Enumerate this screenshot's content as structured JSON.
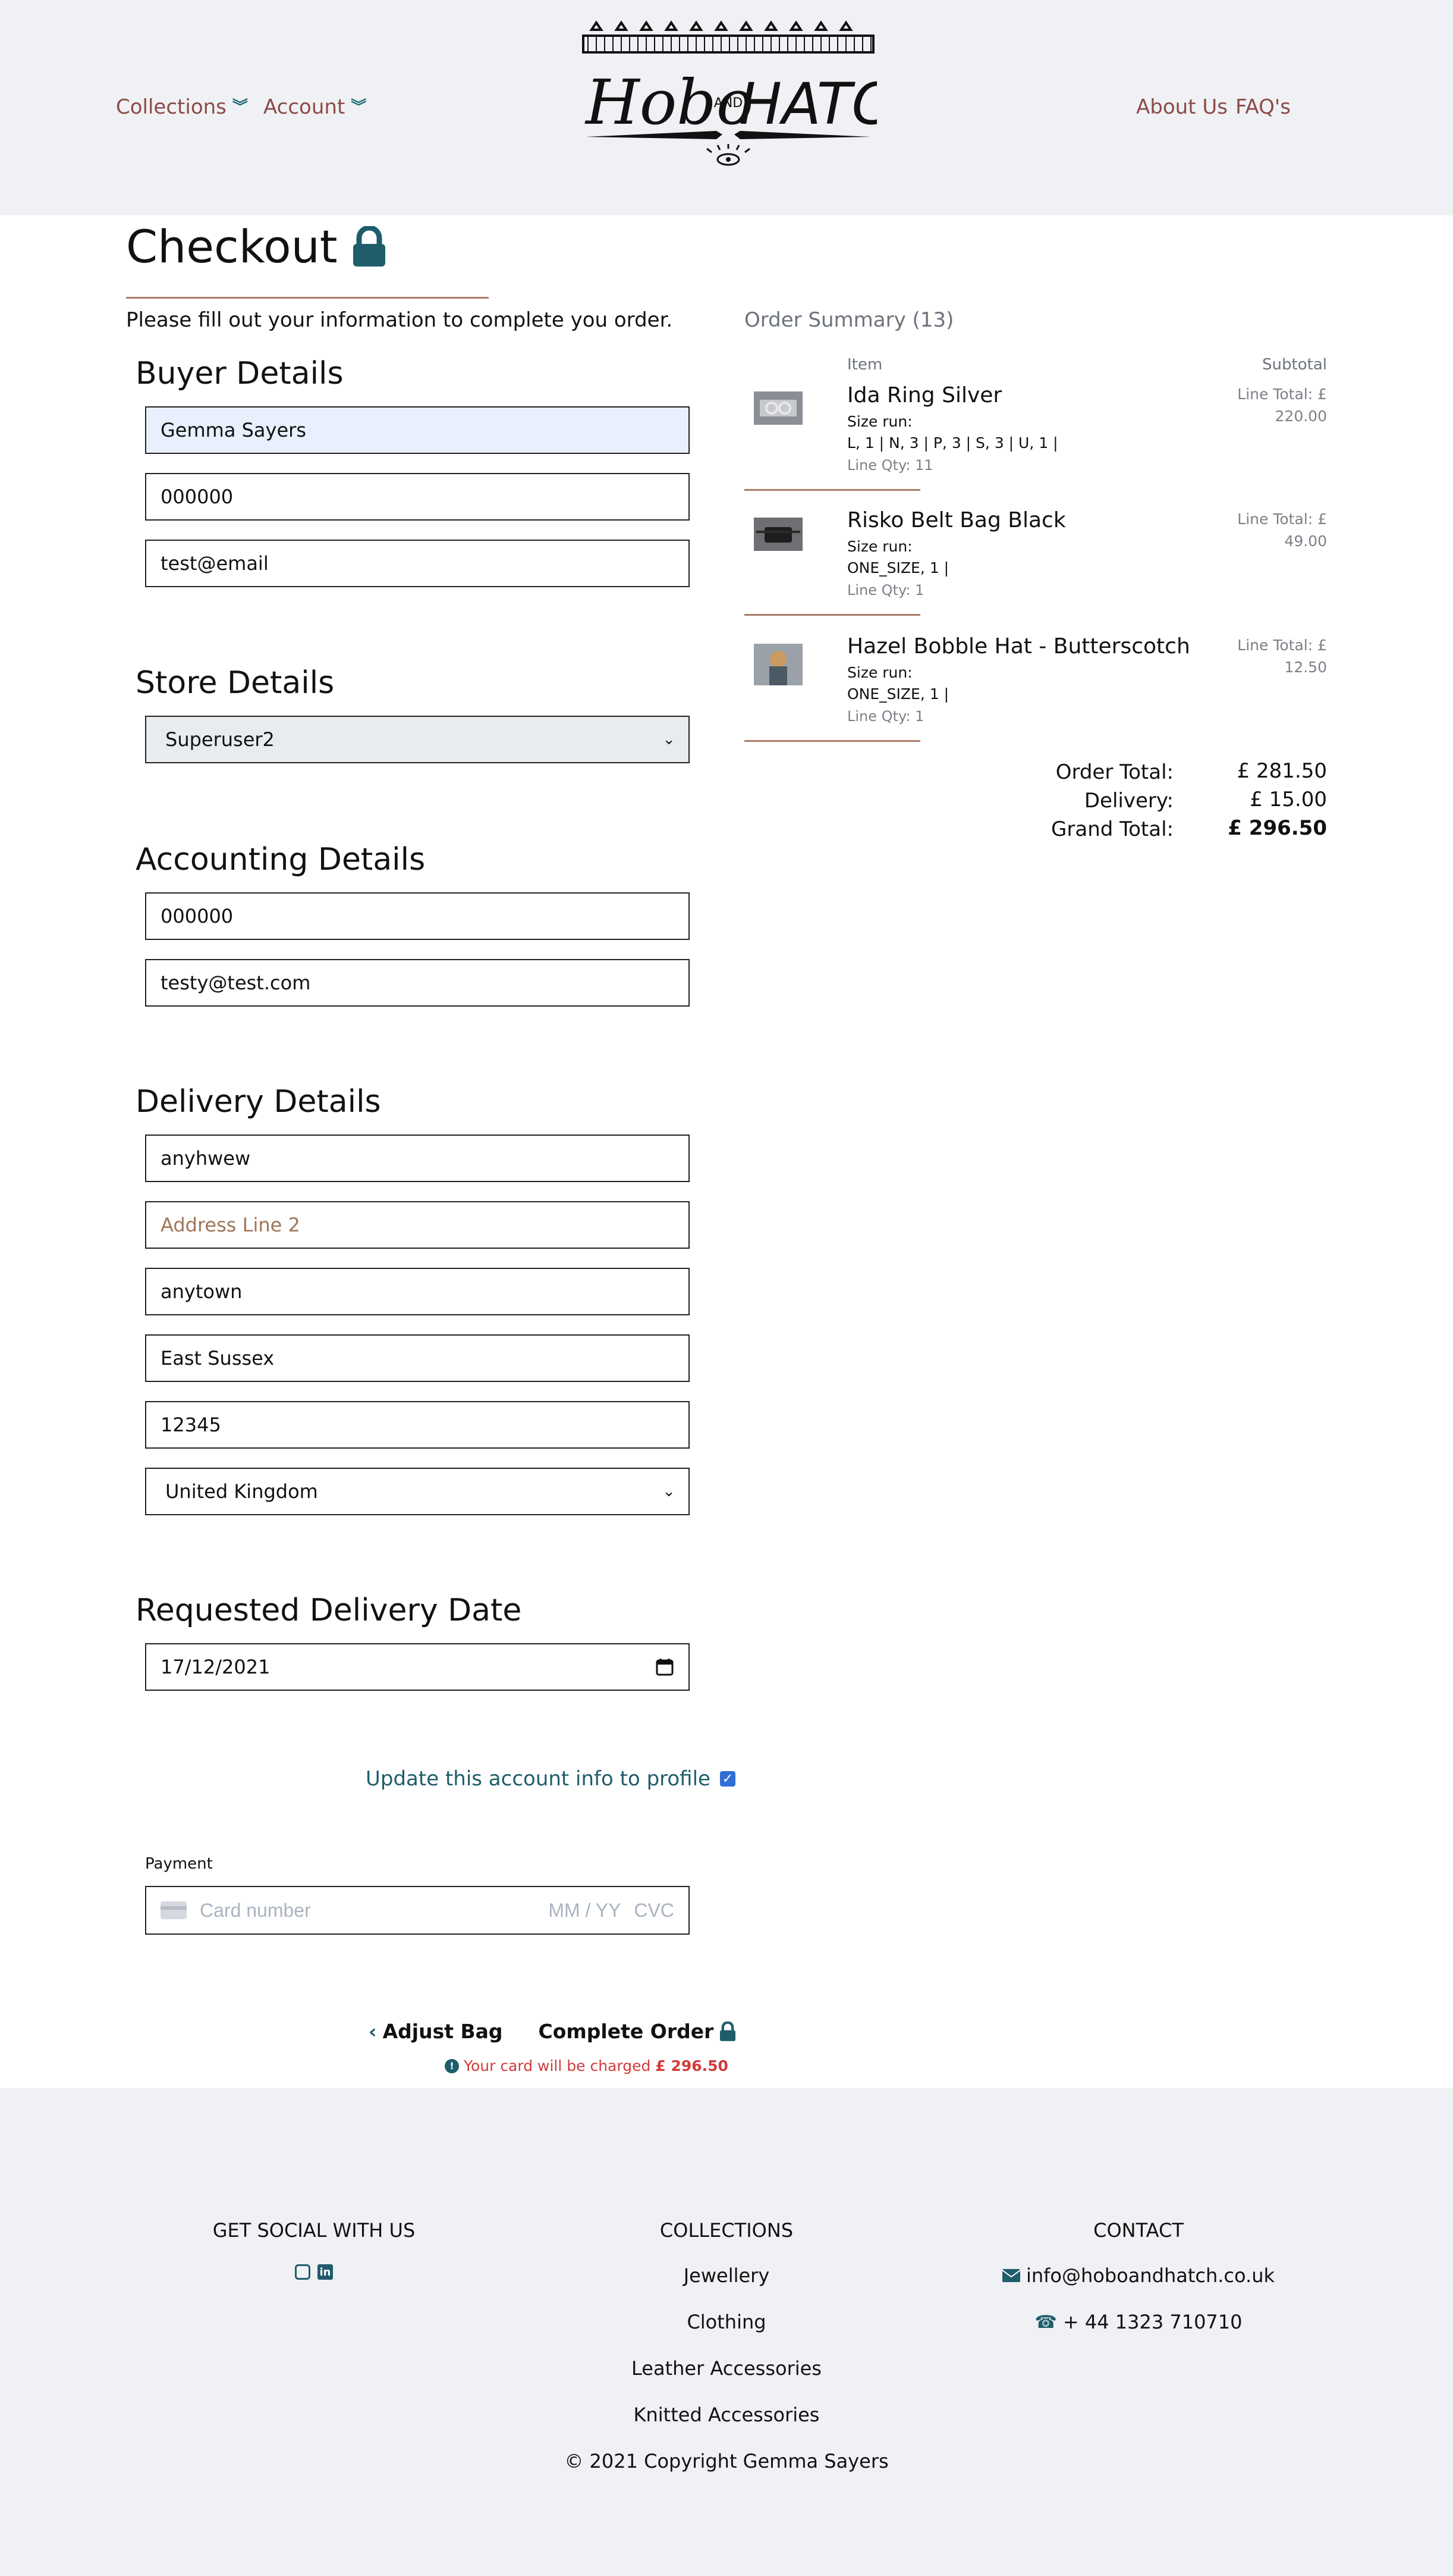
{
  "nav": {
    "collections": "Collections",
    "account": "Account",
    "about": "About Us",
    "faqs": "FAQ's",
    "logo_text_left": "Hobo",
    "logo_text_mid": "AND",
    "logo_text_right": "HATCH"
  },
  "checkout": {
    "title": "Checkout",
    "intro": "Please fill out your information to complete you order."
  },
  "buyer": {
    "heading": "Buyer Details",
    "name": "Gemma Sayers",
    "phone": "000000",
    "email": "test@email"
  },
  "store": {
    "heading": "Store Details",
    "selected": "Superuser2"
  },
  "accounting": {
    "heading": "Accounting Details",
    "phone": "000000",
    "email": "testy@test.com"
  },
  "delivery": {
    "heading": "Delivery Details",
    "line1": "anyhwew",
    "line2_placeholder": "Address Line 2",
    "town": "anytown",
    "county": "East Sussex",
    "postcode": "12345",
    "country": "United Kingdom"
  },
  "requested_date": {
    "heading": "Requested Delivery Date",
    "value": "17/12/2021"
  },
  "update_profile": {
    "label": "Update this account info to profile",
    "checked": true
  },
  "payment": {
    "label": "Payment",
    "card_placeholder": "Card number",
    "expiry_placeholder": "MM / YY",
    "cvc_placeholder": "CVC"
  },
  "actions": {
    "adjust": "Adjust Bag",
    "complete": "Complete Order",
    "charge_note": "Your card will be charged",
    "charge_amount": "£ 296.50"
  },
  "order_summary": {
    "title": "Order Summary (13)",
    "col_item": "Item",
    "col_subtotal": "Subtotal",
    "size_run_label": "Size run:",
    "items": [
      {
        "name": "Ida Ring Silver",
        "size_run": "L, 1 | N, 3 | P, 3 | S, 3 | U, 1 |",
        "qty": "Line Qty: 11",
        "total_label": "Line Total: £",
        "total": "220.00"
      },
      {
        "name": "Risko Belt Bag Black",
        "size_run": "ONE_SIZE, 1 |",
        "qty": "Line Qty: 1",
        "total_label": "Line Total: £",
        "total": "49.00"
      },
      {
        "name": "Hazel Bobble Hat - Butterscotch",
        "size_run": "ONE_SIZE, 1 |",
        "qty": "Line Qty: 1",
        "total_label": "Line Total: £",
        "total": "12.50"
      }
    ],
    "order_total_label": "Order Total:",
    "order_total": "£ 281.50",
    "delivery_label": "Delivery:",
    "delivery": "£ 15.00",
    "grand_total_label": "Grand Total:",
    "grand_total": "£ 296.50"
  },
  "footer": {
    "social_heading": "GET SOCIAL WITH US",
    "collections_heading": "COLLECTIONS",
    "collections": [
      "Jewellery",
      "Clothing",
      "Leather Accessories",
      "Knitted Accessories"
    ],
    "contact_heading": "CONTACT",
    "email": "info@hoboandhatch.co.uk",
    "phone": "+ 44 1323 710710",
    "copyright": "© 2021 Copyright Gemma Sayers"
  },
  "colors": {
    "accent_brown": "#8b4b46",
    "teal": "#1f5d6b",
    "rule": "#a97c6b",
    "header_bg": "#f0f1f4",
    "error_red": "#d23b3b"
  }
}
